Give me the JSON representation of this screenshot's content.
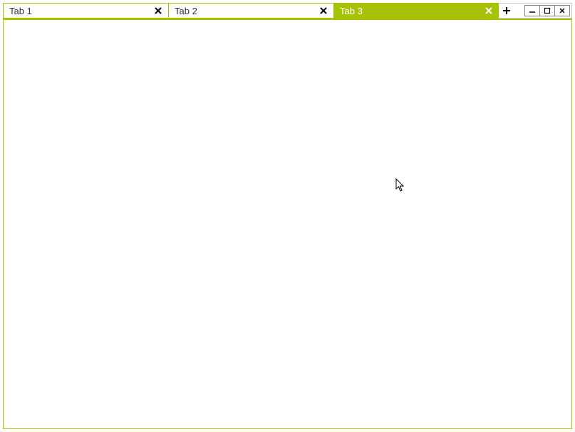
{
  "colors": {
    "accent": "#a7c203"
  },
  "tabs": [
    {
      "label": "Tab 1",
      "active": false
    },
    {
      "label": "Tab 2",
      "active": false
    },
    {
      "label": "Tab 3",
      "active": true
    }
  ]
}
